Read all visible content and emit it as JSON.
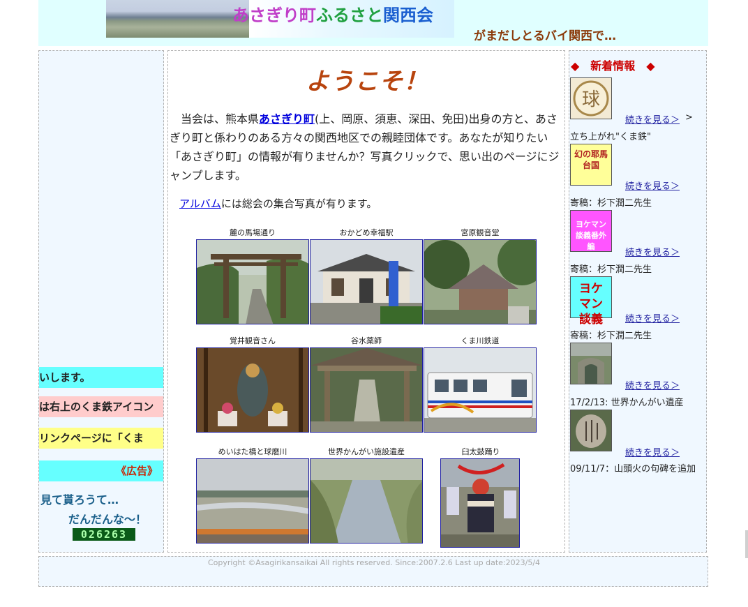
{
  "header": {
    "title_part1": "あさぎり町",
    "title_part2": "ふるさと",
    "title_part3": "関西会",
    "tagline": "がまだしとるバイ関西で…"
  },
  "left": {
    "marquee1": "いします。",
    "marquee2": "は右上のくま鉄アイコン",
    "marquee3": "リンクページに「くま",
    "marquee4": "《広告》",
    "message1": "見て貰ろうて…",
    "message2": "だんだんな～！",
    "counter": "026263"
  },
  "main": {
    "welcome": "ようこそ！",
    "intro_prefix": "　当会は、熊本県",
    "intro_link": "あさぎり町",
    "intro_suffix": "(上、岡原、須恵、深田、免田)出身の方と、あさぎり町と係わりのある方々の関西地区での親睦団体です。あなたが知りたい「あさぎり町」の情報が有りませんか？写真クリックで、思い出のページにジャンプします。",
    "album_link": "アルバム",
    "album_suffix": "には総会の集合写真が有ります。",
    "photos": [
      {
        "caption": "麓の馬場通り"
      },
      {
        "caption": "おかどめ幸福駅"
      },
      {
        "caption": "宮原観音堂"
      },
      {
        "caption": "覚井観音さん"
      },
      {
        "caption": "谷水薬師"
      },
      {
        "caption": "くま川鉄道"
      },
      {
        "caption": "めいはた橋と球磨川"
      },
      {
        "caption": "世界かんがい施設遺産"
      },
      {
        "caption": "臼太鼓踊り"
      }
    ]
  },
  "news": {
    "title": "◆　新着情報　◆",
    "read_more": "続きを見る＞",
    "items": [
      {
        "icon_text": "球",
        "link_suffix": ">",
        "text": "立ち上がれ\"くま鉄\""
      },
      {
        "icon_text": "幻の耶馬台国",
        "text": "寄稿：杉下潤二先生"
      },
      {
        "icon_text": "ヨケマン談義番外編",
        "text": "寄稿：杉下潤二先生"
      },
      {
        "icon_text": "ヨケマン談義",
        "text": "寄稿：杉下潤二先生"
      },
      {
        "icon_text": "",
        "text": "17/2/13: 世界かんがい遺産"
      },
      {
        "icon_text": "",
        "text": "09/11/7：山頭火の句碑を追加"
      }
    ]
  },
  "footer": {
    "copyright": "Copyright ©Asagirikansaikai All rights reserved. Since:2007.2.6 Last up date:2023/5/4"
  },
  "colors": {
    "header_bg": "#e0ffff",
    "panel_bg": "#f0f8ff",
    "welcome": "#b8440e",
    "news_title": "#cc0000",
    "link": "#1f1fa0"
  }
}
